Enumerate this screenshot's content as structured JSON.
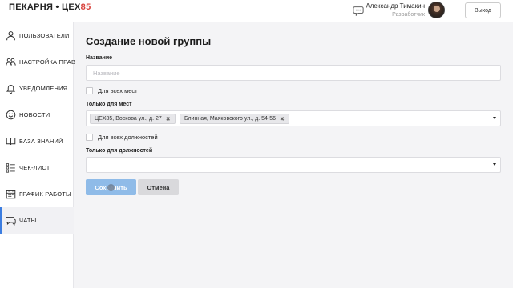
{
  "header": {
    "logo_left": "ПЕКАРНЯ • ЦЕХ",
    "logo_accent": "85",
    "user_name": "Александр Тимакин",
    "user_role": "Разработчик",
    "logout_label": "Выход",
    "accent_color": "#d8413b"
  },
  "sidebar": {
    "items": [
      {
        "label": "ПОЛЬЗОВАТЕЛИ",
        "icon": "user-icon"
      },
      {
        "label": "НАСТРОЙКА ПРАВ",
        "icon": "permissions-icon"
      },
      {
        "label": "УВЕДОМЛЕНИЯ",
        "icon": "bell-icon"
      },
      {
        "label": "НОВОСТИ",
        "icon": "smile-icon"
      },
      {
        "label": "БАЗА ЗНАНИЙ",
        "icon": "book-icon"
      },
      {
        "label": "ЧЕК-ЛИСТ",
        "icon": "checklist-icon"
      },
      {
        "label": "ГРАФИК РАБОТЫ",
        "icon": "calendar-icon"
      },
      {
        "label": "ЧАТЫ",
        "icon": "chat-icon",
        "active": true
      }
    ],
    "active_color": "#3c7de0"
  },
  "main": {
    "title": "Создание новой группы",
    "name_label": "Название",
    "name_placeholder": "Название",
    "name_value": "",
    "all_places_label": "Для всех мест",
    "all_places_checked": false,
    "places_label": "Только для мест",
    "places_selected": [
      "ЦЕХ85, Воскова ул., д. 27",
      "Блинная, Маяковского ул., д. 54-56"
    ],
    "all_positions_label": "Для всех должностей",
    "all_positions_checked": false,
    "positions_label": "Только для должностей",
    "positions_selected": [],
    "save_label": "Сохранить",
    "cancel_label": "Отмена"
  }
}
